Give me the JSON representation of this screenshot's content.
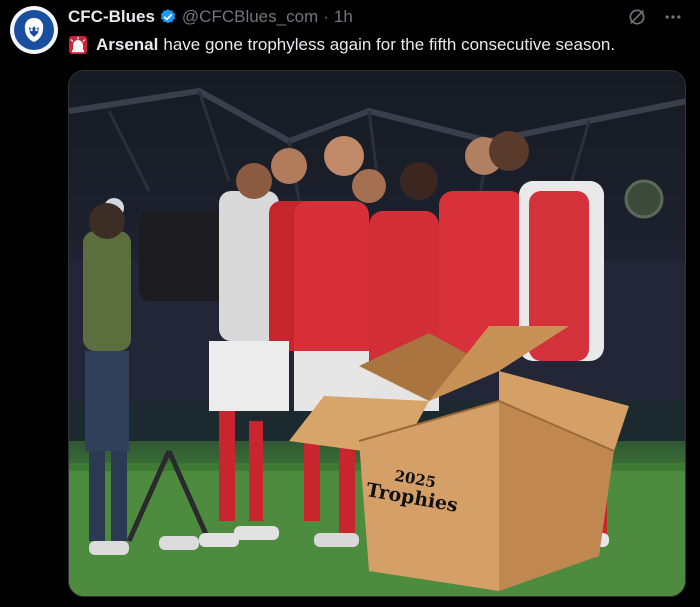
{
  "tweet": {
    "author_name": "CFC-Blues",
    "handle": "@CFCBlues_com",
    "separator": "·",
    "timestamp": "1h",
    "text_bold": "Arsenal",
    "text_rest": "have gone trophyless again for the fifth consecutive season.",
    "icons": {
      "avatar": "lion-crest-icon",
      "verified": "verified-badge-icon",
      "grok": "grok-icon",
      "more": "more-options-icon",
      "siren": "rotating-light-icon"
    },
    "colors": {
      "verified": "#1d9bf0",
      "text_secondary": "#71767b",
      "text_primary": "#e7e9ea"
    }
  },
  "media": {
    "box_year": "2025",
    "box_label": "Trophies"
  }
}
